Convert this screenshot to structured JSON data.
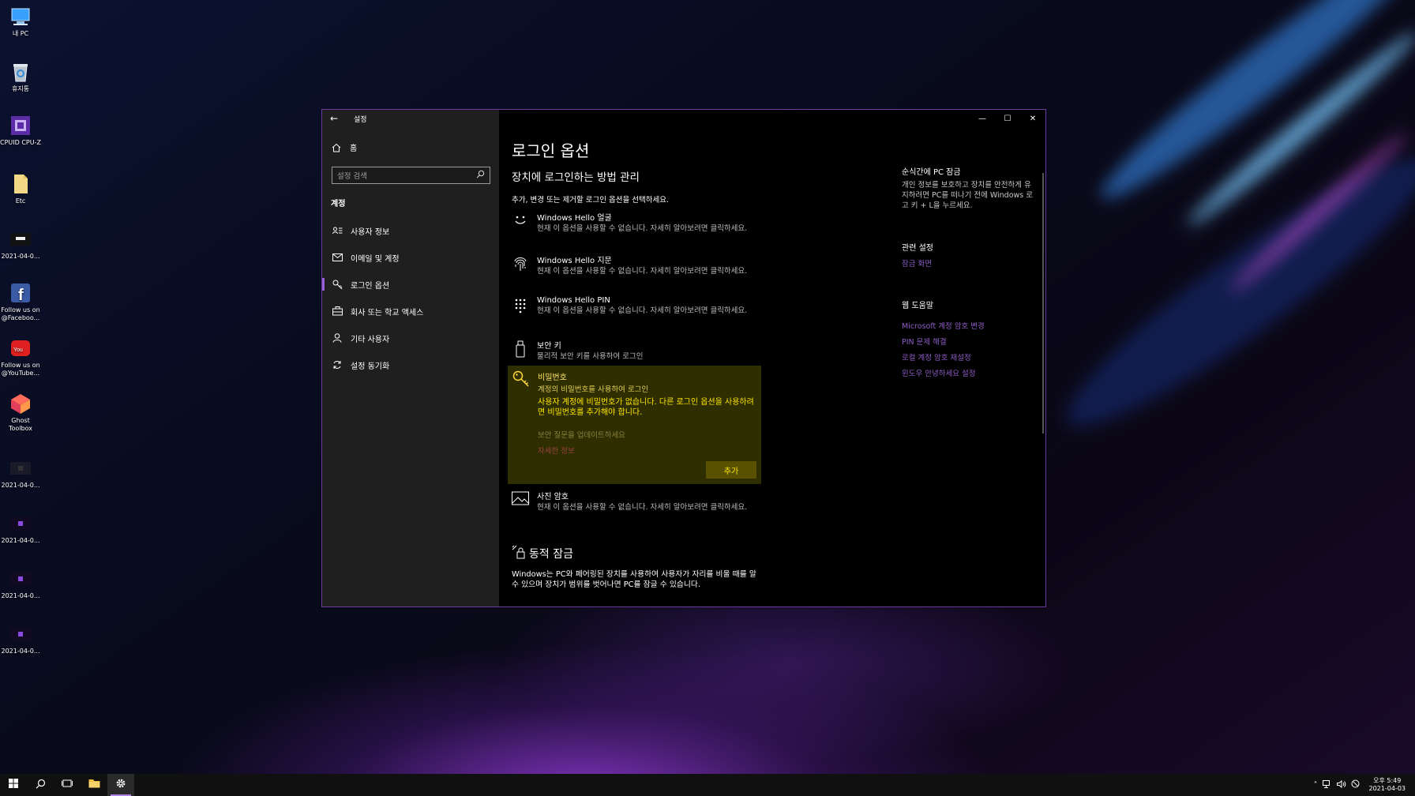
{
  "desktop": {
    "icons": [
      {
        "label": "내 PC"
      },
      {
        "label": "휴지통"
      },
      {
        "label": "CPUID CPU-Z"
      },
      {
        "label": "Etc"
      },
      {
        "label": "2021-04-0..."
      },
      {
        "label": "Follow us on @Faceboo..."
      },
      {
        "label": "Follow us on @YouTube..."
      },
      {
        "label": "Ghost Toolbox"
      },
      {
        "label": "2021-04-0..."
      },
      {
        "label": "2021-04-0..."
      },
      {
        "label": "2021-04-0..."
      },
      {
        "label": "2021-04-0..."
      }
    ]
  },
  "window": {
    "title": "설정",
    "home_label": "홈",
    "search_placeholder": "설정 검색",
    "section_label": "계정",
    "nav": [
      {
        "label": "사용자 정보",
        "icon": "user-info-icon"
      },
      {
        "label": "이메일 및 계정",
        "icon": "mail-icon"
      },
      {
        "label": "로그인 옵션",
        "icon": "key-icon",
        "active": true
      },
      {
        "label": "회사 또는 학교 액세스",
        "icon": "briefcase-icon"
      },
      {
        "label": "기타 사용자",
        "icon": "person-icon"
      },
      {
        "label": "설정 동기화",
        "icon": "sync-icon"
      }
    ]
  },
  "main": {
    "title": "로그인 옵션",
    "subtitle": "장치에 로그인하는 방법 관리",
    "description": "추가, 변경 또는 제거할 로그인 옵션을 선택하세요.",
    "options": [
      {
        "title": "Windows Hello 얼굴",
        "desc": "현재 이 옵션을 사용할 수 없습니다. 자세히 알아보려면 클릭하세요.",
        "icon": "face-icon"
      },
      {
        "title": "Windows Hello 지문",
        "desc": "현재 이 옵션을 사용할 수 없습니다. 자세히 알아보려면 클릭하세요.",
        "icon": "fingerprint-icon"
      },
      {
        "title": "Windows Hello PIN",
        "desc": "현재 이 옵션을 사용할 수 없습니다. 자세히 알아보려면 클릭하세요.",
        "icon": "pin-keypad-icon"
      },
      {
        "title": "보안 키",
        "desc": "물리적 보안 키를 사용하여 로그인",
        "icon": "usb-key-icon"
      }
    ],
    "password": {
      "title": "비밀번호",
      "desc": "계정의 비밀번호를 사용하여 로그인",
      "warning": "사용자 계정에 비밀번호가 없습니다. 다른 로그인 옵션을 사용하려면 비밀번호를 추가해야 합니다.",
      "link_security": "보안 질문을 업데이트하세요",
      "link_more": "자세한 정보",
      "add_button": "추가"
    },
    "picture_password": {
      "title": "사진 암호",
      "desc": "현재 이 옵션을 사용할 수 없습니다. 자세히 알아보려면 클릭하세요."
    },
    "dynamic_lock": {
      "title": "동적 잠금",
      "desc": "Windows는 PC와 페어링된 장치를 사용하여 사용자가 자리를 비울 때를 알 수 있으며 장치가 범위를 벗어나면 PC를 잠글 수 있습니다."
    }
  },
  "aside": {
    "lock_title": "순식간에 PC 잠금",
    "lock_desc": "개인 정보를 보호하고 장치를 안전하게 유지하려면 PC를 떠나기 전에 Windows 로고 키 + L을 누르세요.",
    "related_title": "관련 설정",
    "related_links": [
      "잠금 화면"
    ],
    "help_title": "웹 도움말",
    "help_links": [
      "Microsoft 계정 암호 변경",
      "PIN 문제 해결",
      "로컬 계정 암호 재설정",
      "윈도우 안녕하세요 설정"
    ]
  },
  "taskbar": {
    "time": "오후 5:49",
    "date": "2021-04-03"
  },
  "colors": {
    "accent": "#9a5fd6",
    "link": "#8d5cc6",
    "password_panel": "#2e2e00",
    "warning_text": "#ffe600"
  }
}
